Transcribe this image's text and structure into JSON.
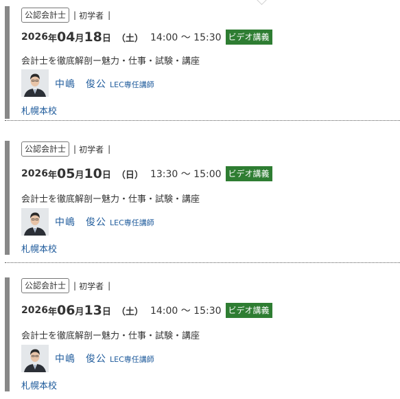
{
  "events": [
    {
      "category": "公認会計士",
      "separator": "|",
      "level": "初学者",
      "year": "2026",
      "year_unit": "年",
      "month": "04",
      "month_unit": "月",
      "day": "18",
      "day_unit": "日",
      "weekday": "（土）",
      "time": "14:00 ～ 15:30",
      "format_badge": "ビデオ講義",
      "title": "会計士を徹底解剖ー魅力・仕事・試験・講座",
      "instructor_name": "中嶋　俊公",
      "instructor_role": "LEC専任講師",
      "school": "札幌本校"
    },
    {
      "category": "公認会計士",
      "separator": "|",
      "level": "初学者",
      "year": "2026",
      "year_unit": "年",
      "month": "05",
      "month_unit": "月",
      "day": "10",
      "day_unit": "日",
      "weekday": "（日）",
      "time": "13:30 ～ 15:00",
      "format_badge": "ビデオ講義",
      "title": "会計士を徹底解剖ー魅力・仕事・試験・講座",
      "instructor_name": "中嶋　俊公",
      "instructor_role": "LEC専任講師",
      "school": "札幌本校"
    },
    {
      "category": "公認会計士",
      "separator": "|",
      "level": "初学者",
      "year": "2026",
      "year_unit": "年",
      "month": "06",
      "month_unit": "月",
      "day": "13",
      "day_unit": "日",
      "weekday": "（土）",
      "time": "14:00 ～ 15:30",
      "format_badge": "ビデオ講義",
      "title": "会計士を徹底解剖ー魅力・仕事・試験・講座",
      "instructor_name": "中嶋　俊公",
      "instructor_role": "LEC専任講師",
      "school": "札幌本校"
    }
  ],
  "colors": {
    "accent_green": "#2e7d32",
    "link_blue": "#1d5a9b",
    "bar_gray": "#888888"
  }
}
